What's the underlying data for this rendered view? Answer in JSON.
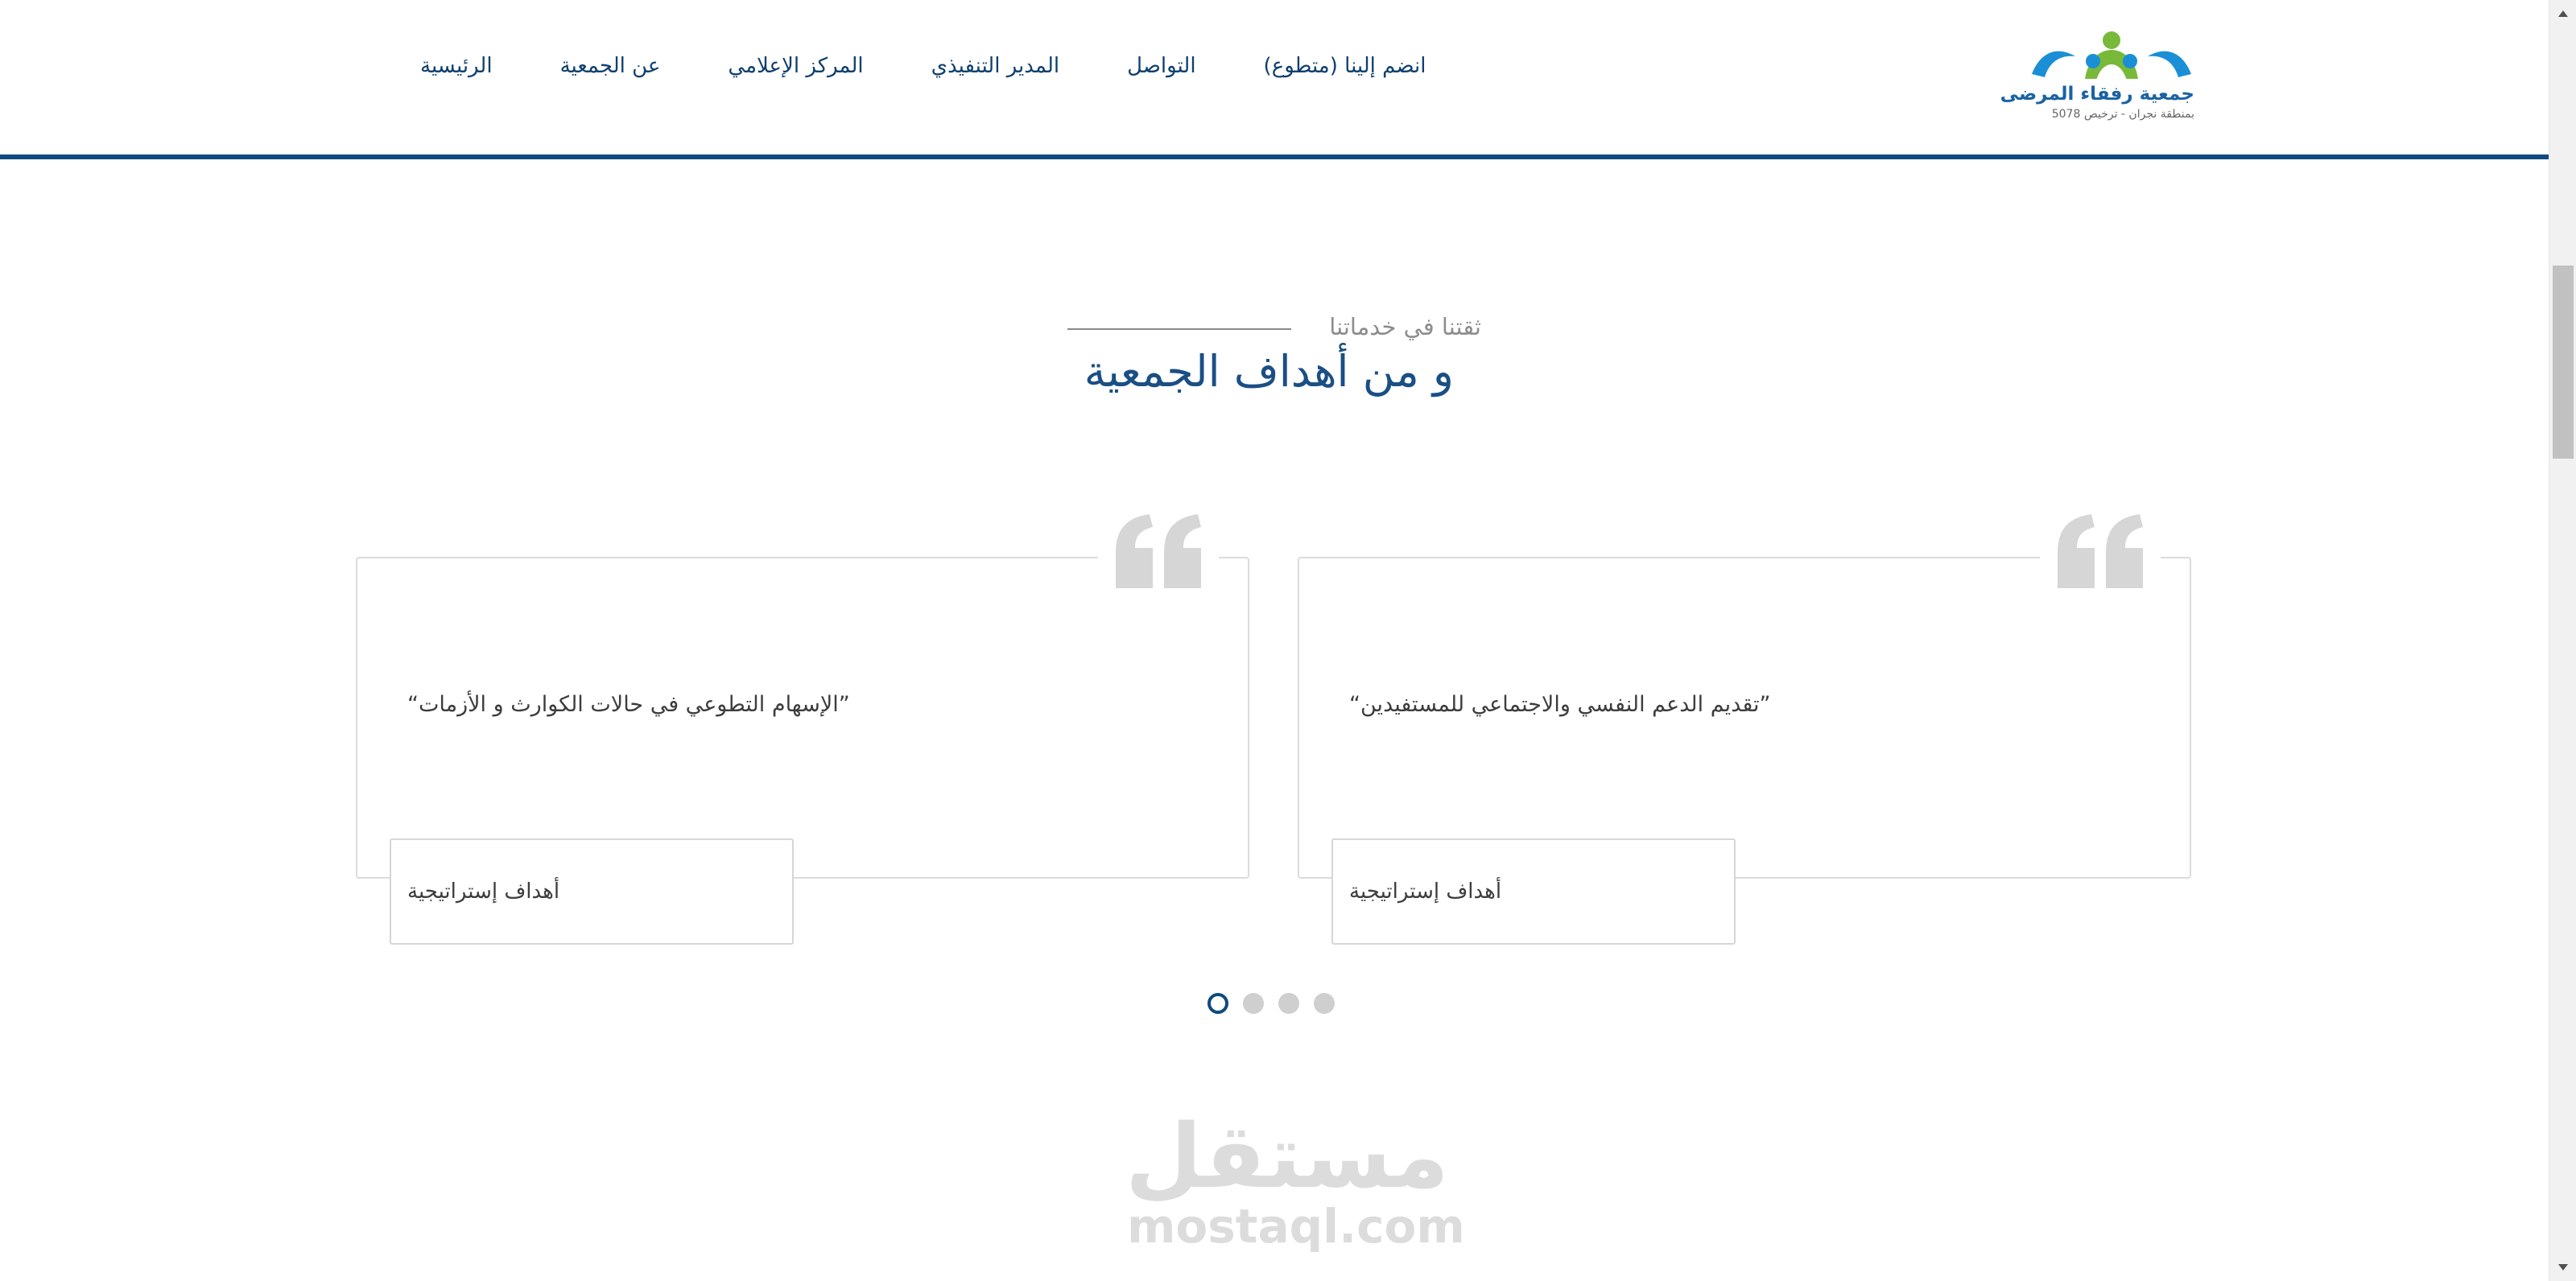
{
  "header": {
    "logo": {
      "title": "جمعية رفقاء المرضى",
      "subtitle": "بمنطقة نجران - ترخيص 5078",
      "colors": {
        "blue": "#1a8fd6",
        "green": "#79b93a"
      }
    },
    "nav": [
      {
        "label": "الرئيسية"
      },
      {
        "label": "عن الجمعية"
      },
      {
        "label": "المركز الإعلامي"
      },
      {
        "label": "المدير التنفيذي"
      },
      {
        "label": "التواصل"
      },
      {
        "label": "انضم إلينا (متطوع)"
      }
    ],
    "accent_color": "#0f4a7e"
  },
  "section": {
    "eyebrow": "ثقتنا في خدماتنا",
    "title": "و من أهداف الجمعية"
  },
  "cards": [
    {
      "quote_icon": "quote-icon",
      "text": "“تقديم الدعم النفسي والاجتماعي للمستفيدين”",
      "tag": "أهداف إستراتيجية"
    },
    {
      "quote_icon": "quote-icon",
      "text": "“الإسهام التطوعي في حالات الكوارث و الأزمات”",
      "tag": "أهداف إستراتيجية"
    }
  ],
  "carousel": {
    "total": 4,
    "active": 1
  },
  "watermark": {
    "arabic": "مستقل",
    "latin": "mostaql.com"
  }
}
